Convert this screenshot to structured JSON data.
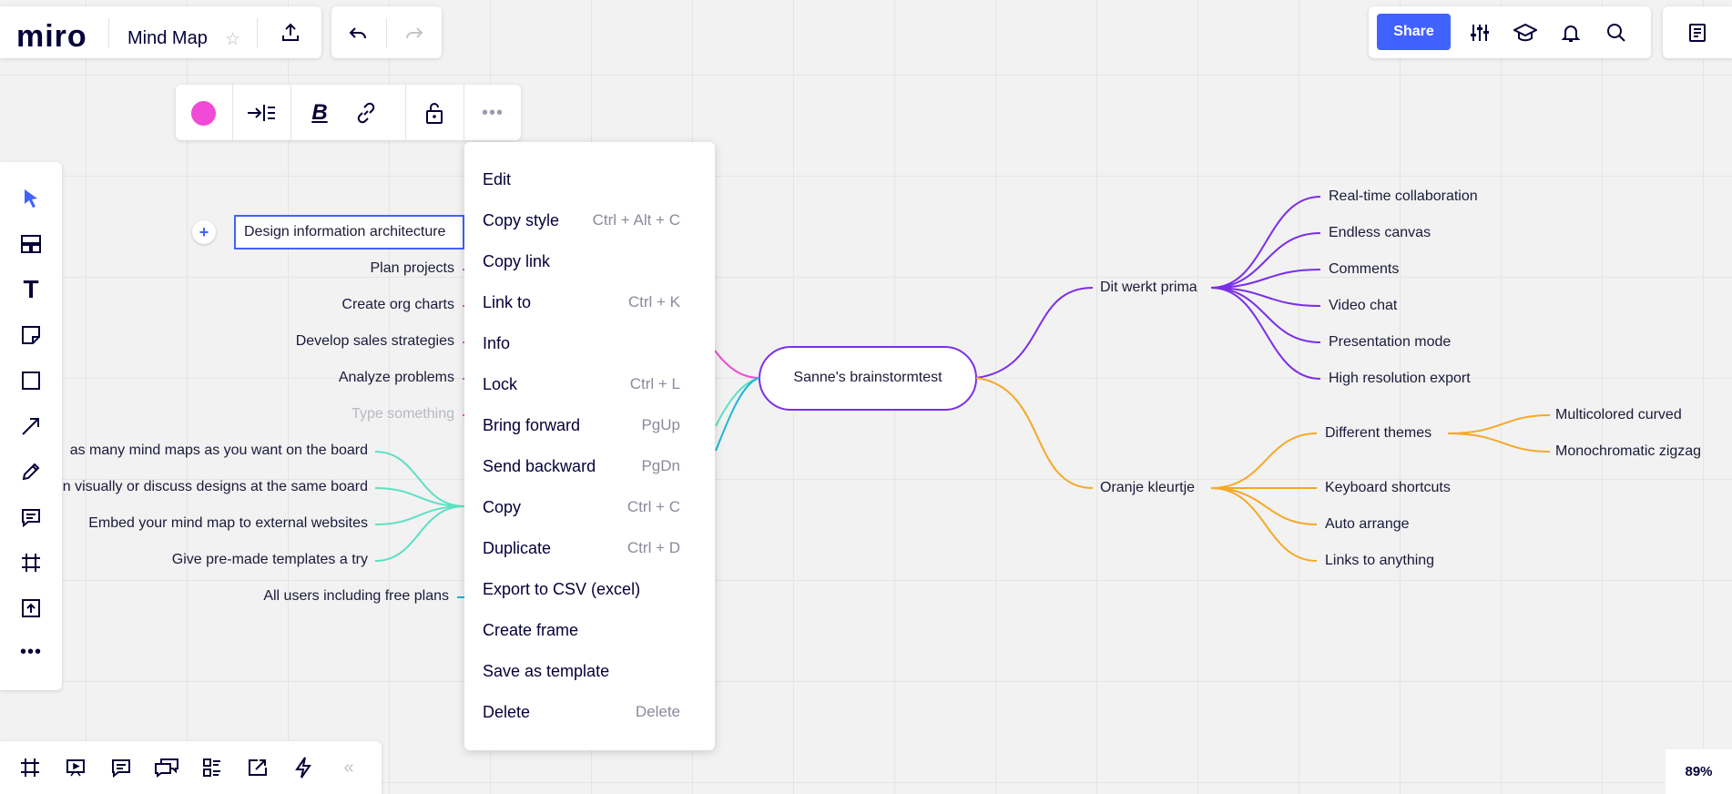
{
  "app": {
    "logo": "miro",
    "board_title": "Mind Map",
    "share_label": "Share",
    "zoom": "89%"
  },
  "colors": {
    "accent": "#4262ff",
    "purple": "#7b2ee6",
    "orange": "#f7a824",
    "teal": "#5de0c4",
    "pink": "#f04ad6",
    "cyan": "#17b7d8"
  },
  "icons": {
    "top_left": [
      "star-icon",
      "upload-icon",
      "undo-icon",
      "redo-icon"
    ],
    "top_right": [
      "settings-sliders-icon",
      "education-cap-icon",
      "bell-icon",
      "search-icon",
      "notes-icon"
    ],
    "side_tools": [
      "select-cursor-icon",
      "templates-icon",
      "text-icon",
      "sticky-note-icon",
      "shape-icon",
      "arrow-icon",
      "pen-icon",
      "comment-icon",
      "frame-icon",
      "upload-icon",
      "more-icon"
    ],
    "bottom_tools": [
      "frames-icon",
      "presentation-icon",
      "comments-icon",
      "chat-icon",
      "cards-icon",
      "share-screen-icon",
      "lightning-icon",
      "collapse-icon"
    ],
    "context_toolbar": [
      "color-dot-icon",
      "indent-icon",
      "bold-icon",
      "link-icon",
      "lock-icon",
      "more-icon"
    ]
  },
  "mindmap": {
    "center": "Sanne's brainstormtest",
    "left_nodes": [
      "Design information architecture",
      "Plan projects",
      "Create org charts",
      "Develop sales strategies",
      "Analyze problems",
      "Type something",
      "as many mind maps as you want on the board",
      "n visually or discuss designs at the same board",
      "Embed your mind map to external websites",
      "Give pre-made templates a try",
      "All users including free plans"
    ],
    "purple": {
      "label": "Dit werkt prima",
      "children": [
        "Real-time collaboration",
        "Endless canvas",
        "Comments",
        "Video chat",
        "Presentation mode",
        "High resolution export"
      ]
    },
    "orange": {
      "label": "Oranje kleurtje",
      "children": [
        "Different themes",
        "Keyboard shortcuts",
        "Auto arrange",
        "Links to anything"
      ],
      "theme_children": [
        "Multicolored curved",
        "Monochromatic zigzag"
      ]
    }
  },
  "context_menu": [
    {
      "label": "Edit",
      "shortcut": ""
    },
    {
      "label": "Copy style",
      "shortcut": "Ctrl + Alt + C"
    },
    {
      "label": "Copy link",
      "shortcut": ""
    },
    {
      "label": "Link to",
      "shortcut": "Ctrl + K"
    },
    {
      "label": "Info",
      "shortcut": ""
    },
    {
      "label": "Lock",
      "shortcut": "Ctrl + L"
    },
    {
      "label": "Bring forward",
      "shortcut": "PgUp"
    },
    {
      "label": "Send backward",
      "shortcut": "PgDn"
    },
    {
      "label": "Copy",
      "shortcut": "Ctrl + C"
    },
    {
      "label": "Duplicate",
      "shortcut": "Ctrl + D"
    },
    {
      "label": "Export to CSV (excel)",
      "shortcut": ""
    },
    {
      "label": "Create frame",
      "shortcut": ""
    },
    {
      "label": "Save as template",
      "shortcut": ""
    },
    {
      "label": "Delete",
      "shortcut": "Delete"
    }
  ]
}
